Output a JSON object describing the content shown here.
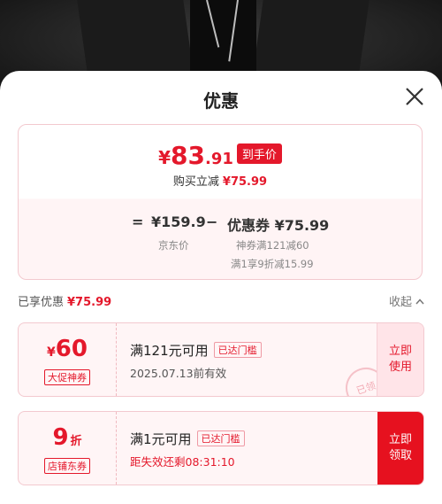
{
  "sheet": {
    "title": "优惠"
  },
  "summary": {
    "currency": "¥",
    "price_int": "83",
    "price_dec": ".91",
    "price_tag": "到手价",
    "instant_label": "购买立减",
    "instant_amount": "¥75.99",
    "eq": "=",
    "base_price": "¥159.9",
    "minus": "−",
    "coupon_total": "优惠券 ¥75.99",
    "base_price_label": "京东价",
    "coupon_line1": "神券满121减60",
    "coupon_line2": "满1享9折减15.99"
  },
  "enjoyed": {
    "label": "已享优惠",
    "amount": "¥75.99",
    "collapse_label": "收起"
  },
  "coupons": [
    {
      "currency": "¥",
      "value": "60",
      "unit": "",
      "type": "大促神券",
      "condition": "满121元可用",
      "badge": "已达门槛",
      "desc": "2025.07.13前有效",
      "button": "立即\n使用",
      "stamp": "已领"
    },
    {
      "currency": "",
      "value": "9",
      "unit": "折",
      "type": "店铺东券",
      "condition": "满1元可用",
      "badge": "已达门槛",
      "desc": "距失效还剩08:31:10",
      "button": "立即\n领取"
    }
  ],
  "colors": {
    "accent": "#e4182b",
    "pink_border": "#f3c9cf",
    "pink_bg": "#fff5f6"
  },
  "icons": {
    "close": "close-icon",
    "collapse": "chevron-up-icon"
  }
}
